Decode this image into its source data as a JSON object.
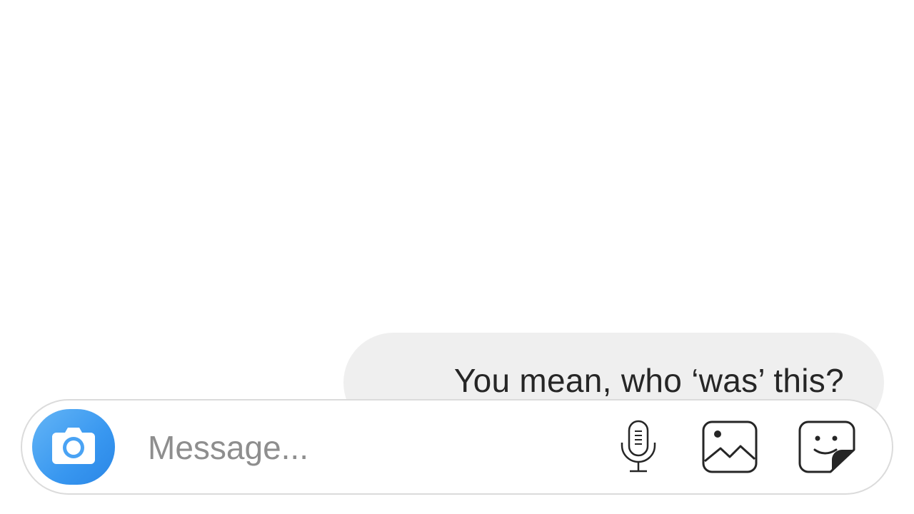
{
  "thread": {
    "messages": [
      {
        "sender": "me",
        "text": "You mean, who ‘was’ this?"
      }
    ]
  },
  "composer": {
    "placeholder": "Message...",
    "value": "",
    "icons": {
      "camera": "camera-icon",
      "mic": "microphone-icon",
      "gallery": "gallery-icon",
      "sticker": "sticker-icon"
    },
    "accent_color": "#3897f0"
  }
}
